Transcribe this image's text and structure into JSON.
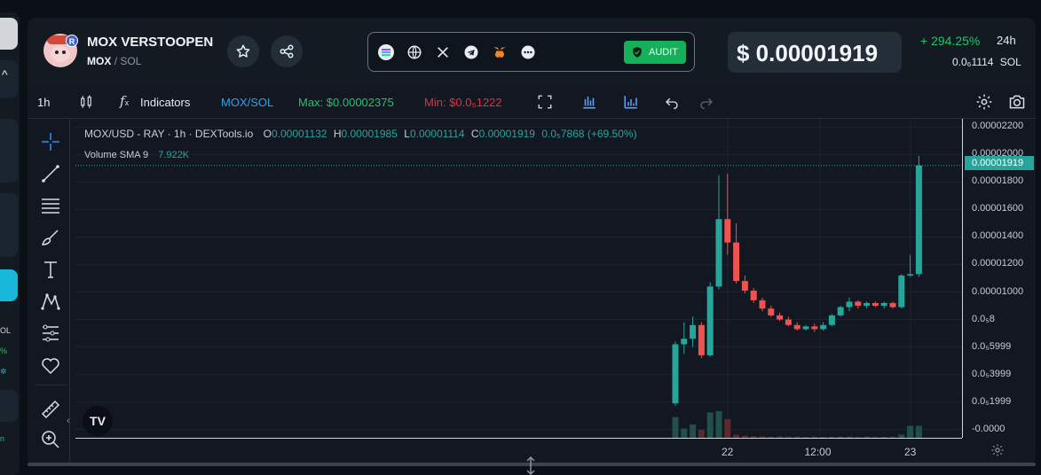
{
  "token": {
    "name": "MOX VERSTOOPEN",
    "symbol": "MOX",
    "quote": "SOL",
    "pair_separator": "/",
    "avatar_badge": "R"
  },
  "socials": {
    "icons": [
      "solana-icon",
      "globe-icon",
      "x-twitter-icon",
      "telegram-icon",
      "metamask-icon",
      "more-icon"
    ],
    "audit_label": "AUDIT"
  },
  "price": {
    "usd": "$ 0.00001919",
    "change": "+ 294.25%",
    "period": "24h",
    "sol_value": "0.0₆1114",
    "sol_unit": "SOL"
  },
  "toolbar": {
    "interval": "1h",
    "indicators_label": "Indicators",
    "pair": "MOX/SOL",
    "max": "Max: $0.00002375",
    "min": "Min: $0.0₅1222"
  },
  "legend": {
    "title": "MOX/USD - RAY · 1h · DEXTools.io",
    "o_label": "O",
    "o": "0.00001132",
    "h_label": "H",
    "h": "0.00001985",
    "l_label": "L",
    "l": "0.00001114",
    "c_label": "C",
    "c": "0.00001919",
    "change": "0.0₅7868 (+69.50%)",
    "volume_label": "Volume SMA 9",
    "volume_value": "7.922K"
  },
  "colors": {
    "up": "#26a69a",
    "down": "#ef5350",
    "accent_green": "#21c46a",
    "pair_blue": "#2fa4e7",
    "min_red": "#e0323f"
  },
  "chart_data": {
    "type": "candlestick",
    "title": "MOX/USD - RAY · 1h · DEXTools.io",
    "ytick_labels": [
      "0.00002200",
      "0.00002000",
      "0.00001800",
      "0.00001600",
      "0.00001400",
      "0.00001200",
      "0.00001000",
      "0.0₅8",
      "0.0₅5999",
      "0.0₅3999",
      "0.0₅1999",
      "-0.0000"
    ],
    "ytick_values": [
      2.2e-05,
      2e-05,
      1.8e-05,
      1.6e-05,
      1.4e-05,
      1.2e-05,
      1e-05,
      8e-06,
      6e-06,
      4e-06,
      2e-06,
      0
    ],
    "xtick_labels": [
      "22",
      "12:00",
      "23"
    ],
    "current_price_label": "0.00001919",
    "ylim": [
      -6e-07,
      2.26e-05
    ],
    "candles": [
      {
        "o": 1.9e-06,
        "h": 6.4e-06,
        "l": 1.7e-06,
        "c": 6.2e-06
      },
      {
        "o": 6.2e-06,
        "h": 7.8e-06,
        "l": 5.5e-06,
        "c": 6.6e-06
      },
      {
        "o": 6.6e-06,
        "h": 8.2e-06,
        "l": 6e-06,
        "c": 7.6e-06
      },
      {
        "o": 7.6e-06,
        "h": 7.8e-06,
        "l": 5.2e-06,
        "c": 5.4e-06
      },
      {
        "o": 5.4e-06,
        "h": 1.07e-05,
        "l": 5.3e-06,
        "c": 1.04e-05
      },
      {
        "o": 1.04e-05,
        "h": 1.85e-05,
        "l": 1.02e-05,
        "c": 1.53e-05
      },
      {
        "o": 1.53e-05,
        "h": 1.86e-05,
        "l": 1.27e-05,
        "c": 1.36e-05
      },
      {
        "o": 1.36e-05,
        "h": 1.5e-05,
        "l": 1.06e-05,
        "c": 1.08e-05
      },
      {
        "o": 1.08e-05,
        "h": 1.12e-05,
        "l": 9.9e-06,
        "c": 1.01e-05
      },
      {
        "o": 1.01e-05,
        "h": 1.03e-05,
        "l": 9.2e-06,
        "c": 9.4e-06
      },
      {
        "o": 9.4e-06,
        "h": 9.6e-06,
        "l": 8.6e-06,
        "c": 8.8e-06
      },
      {
        "o": 8.8e-06,
        "h": 9e-06,
        "l": 8.2e-06,
        "c": 8.3e-06
      },
      {
        "o": 8.3e-06,
        "h": 8.5e-06,
        "l": 7.9e-06,
        "c": 8e-06
      },
      {
        "o": 8e-06,
        "h": 8.2e-06,
        "l": 7.5e-06,
        "c": 7.6e-06
      },
      {
        "o": 7.6e-06,
        "h": 7.8e-06,
        "l": 7.2e-06,
        "c": 7.3e-06
      },
      {
        "o": 7.3e-06,
        "h": 7.6e-06,
        "l": 7.2e-06,
        "c": 7.5e-06
      },
      {
        "o": 7.5e-06,
        "h": 7.7e-06,
        "l": 7.1e-06,
        "c": 7.3e-06
      },
      {
        "o": 7.3e-06,
        "h": 7.8e-06,
        "l": 7.2e-06,
        "c": 7.6e-06
      },
      {
        "o": 7.6e-06,
        "h": 8.4e-06,
        "l": 7.5e-06,
        "c": 8.3e-06
      },
      {
        "o": 8.3e-06,
        "h": 9e-06,
        "l": 8.2e-06,
        "c": 8.9e-06
      },
      {
        "o": 8.9e-06,
        "h": 9.6e-06,
        "l": 8.6e-06,
        "c": 9.3e-06
      },
      {
        "o": 9.3e-06,
        "h": 9.4e-06,
        "l": 8.8e-06,
        "c": 9e-06
      },
      {
        "o": 9e-06,
        "h": 9.3e-06,
        "l": 8.8e-06,
        "c": 9.2e-06
      },
      {
        "o": 9.2e-06,
        "h": 9.3e-06,
        "l": 8.9e-06,
        "c": 9e-06
      },
      {
        "o": 9e-06,
        "h": 9.3e-06,
        "l": 8.8e-06,
        "c": 9.2e-06
      },
      {
        "o": 9.2e-06,
        "h": 9.3e-06,
        "l": 8.8e-06,
        "c": 8.9e-06
      },
      {
        "o": 8.9e-06,
        "h": 1.13e-05,
        "l": 8.8e-06,
        "c": 1.12e-05
      },
      {
        "o": 1.12e-05,
        "h": 1.27e-05,
        "l": 1.11e-05,
        "c": 1.13e-05
      },
      {
        "o": 1.13e-05,
        "h": 1.99e-05,
        "l": 1.11e-05,
        "c": 1.92e-05
      }
    ],
    "volume": [
      0.78,
      0.35,
      0.5,
      0.3,
      0.95,
      1.0,
      0.7,
      0.12,
      0.08,
      0.06,
      0.05,
      0.04,
      0.05,
      0.04,
      0.04,
      0.03,
      0.04,
      0.03,
      0.03,
      0.04,
      0.04,
      0.03,
      0.04,
      0.03,
      0.03,
      0.04,
      0.12,
      0.45,
      0.45
    ],
    "volume_max_label": "7.922K"
  }
}
